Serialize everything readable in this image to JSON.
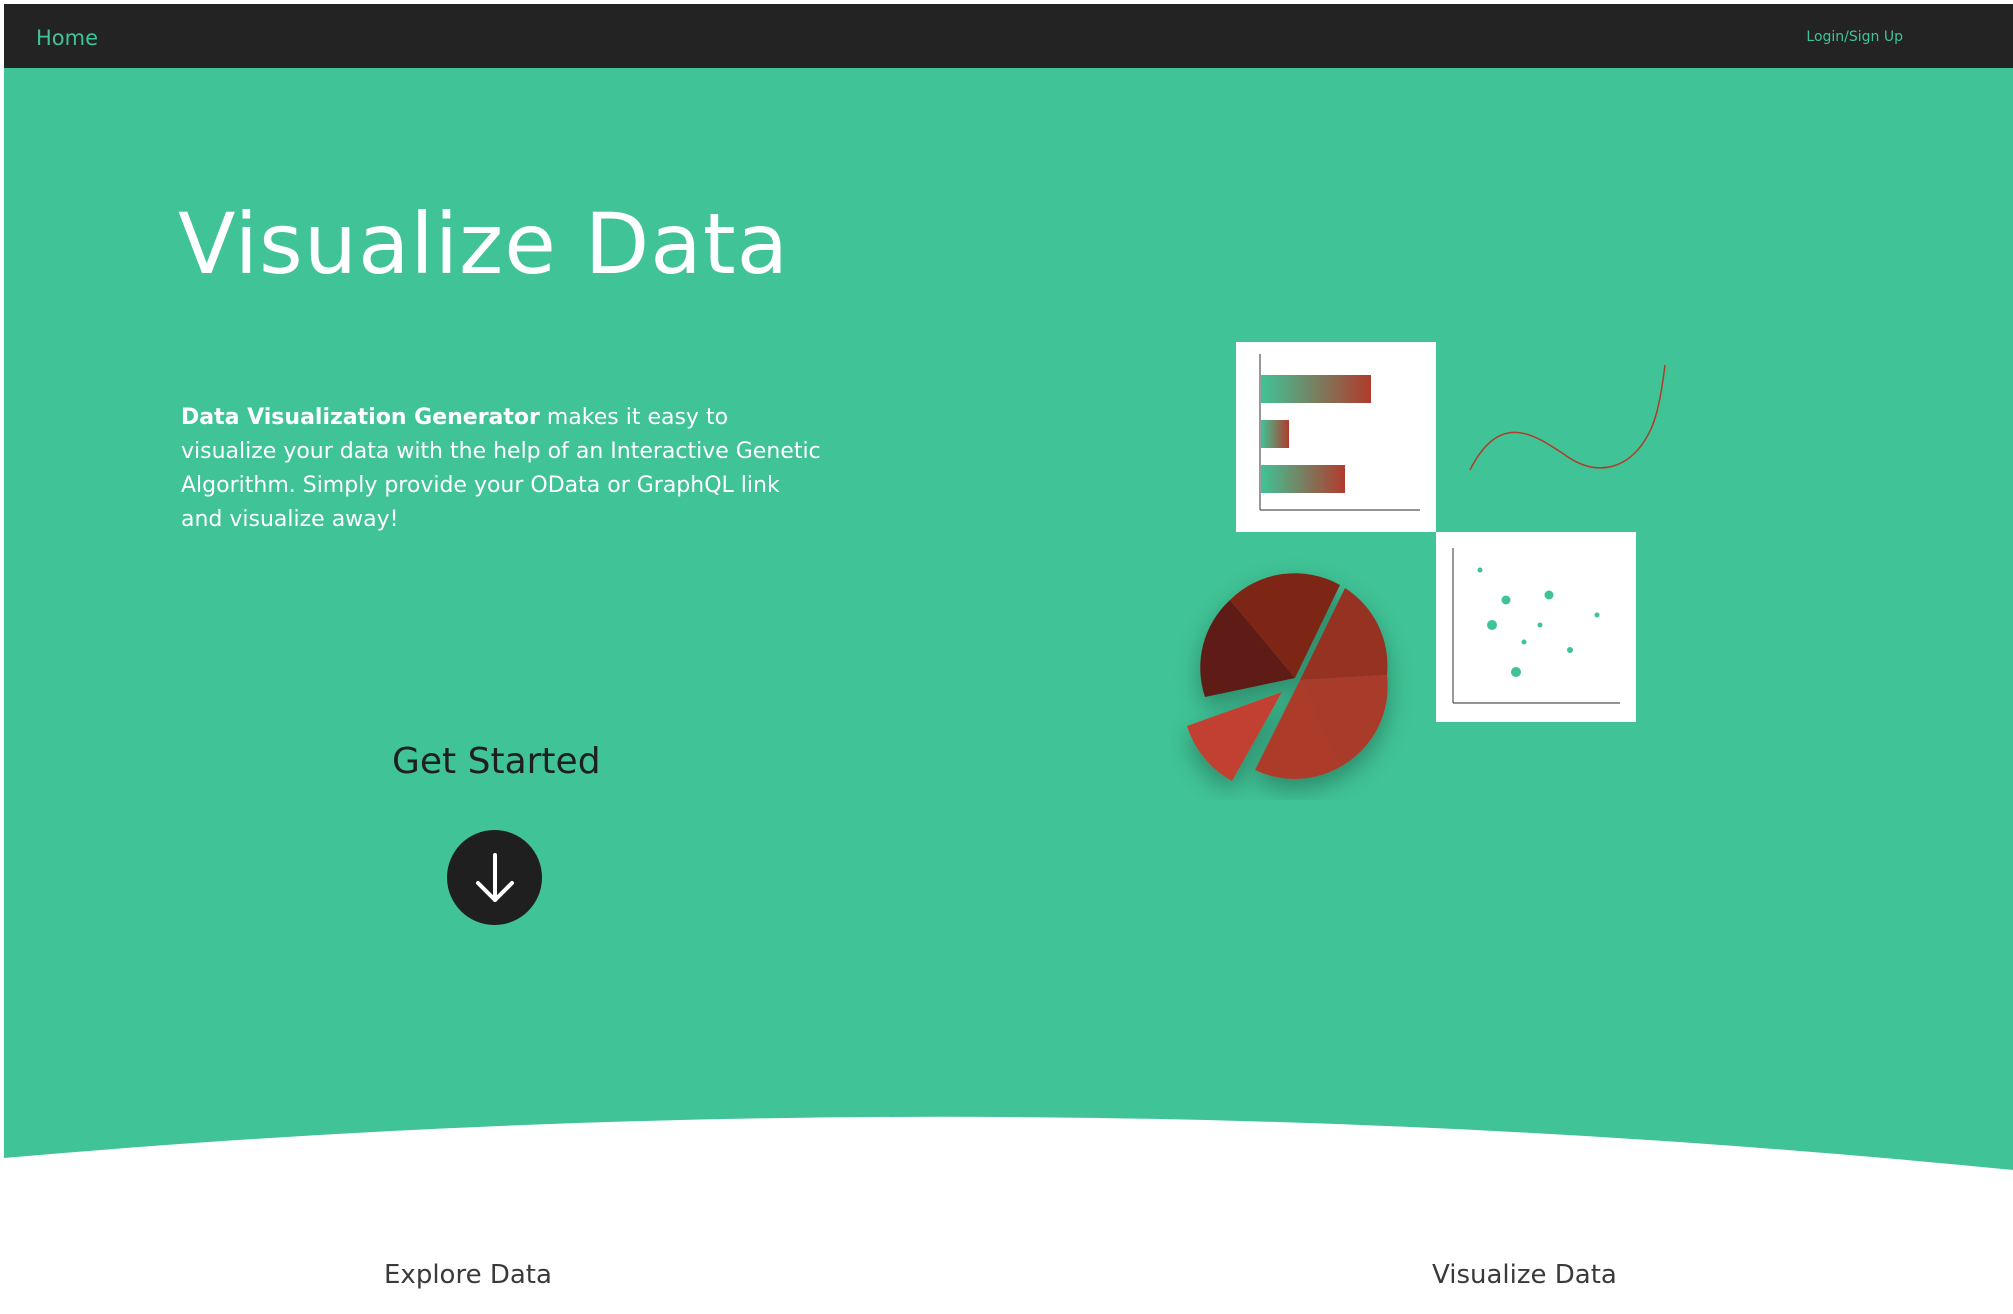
{
  "nav": {
    "home_label": "Home",
    "login_label": "Login/Sign Up"
  },
  "hero": {
    "title": "Visualize Data",
    "description_bold": "Data Visualization Generator",
    "description_rest": " makes it easy to visualize your data with the help of an Interactive Genetic Algorithm. Simply provide your OData or GraphQL link and visualize away!",
    "cta_label": "Get Started",
    "cta_icon": "arrow-down-icon"
  },
  "sections": {
    "explore_label": "Explore Data",
    "visualize_label": "Visualize Data"
  },
  "colors": {
    "accent": "#40c396",
    "nav_bg": "#232323",
    "dark": "#1f1f1f",
    "chart_red": "#a8382a"
  },
  "illustration": {
    "icons": [
      "bar-chart-icon",
      "line-chart-icon",
      "scatter-plot-icon",
      "pie-chart-icon"
    ]
  }
}
